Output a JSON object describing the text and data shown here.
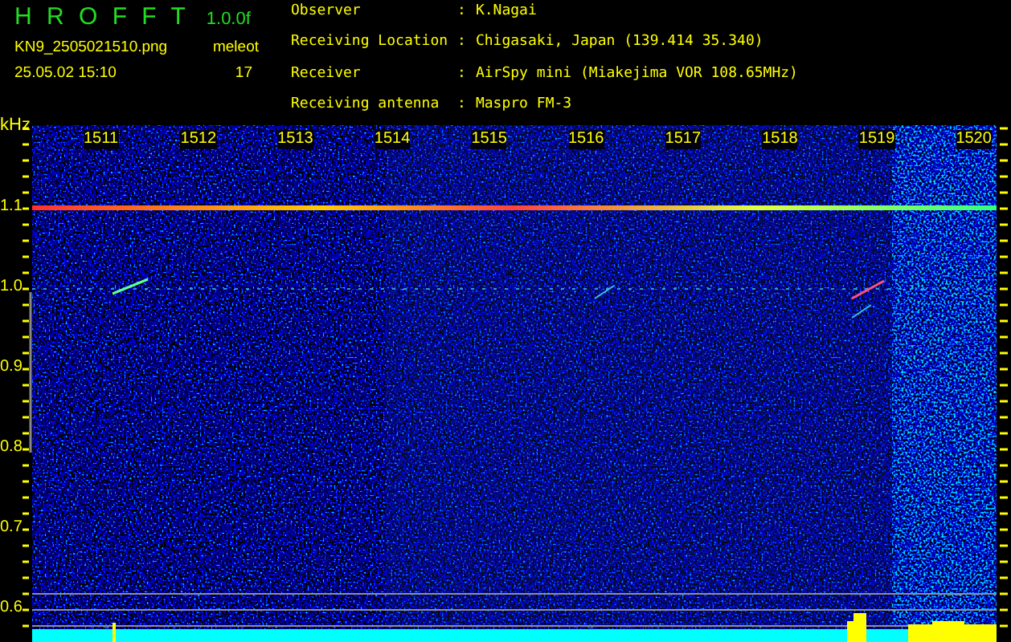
{
  "header": {
    "app_name": "H R O F F T",
    "version": "1.0.0f",
    "file_name": "KN9_2505021510.png",
    "date_time": "25.05.02 15:10",
    "count_label": "meleot",
    "count": "17"
  },
  "station_info": [
    {
      "label": "Observer",
      "separator": ":",
      "value": "K.Nagai"
    },
    {
      "label": "Receiving Location",
      "separator": ":",
      "value": "Chigasaki, Japan (139.414 35.340)"
    },
    {
      "label": "Receiver",
      "separator": ":",
      "value": "AirSpy mini (Miakejima VOR 108.65MHz)"
    },
    {
      "label": "Receiving antenna",
      "separator": ":",
      "value": "Maspro FM-3"
    }
  ],
  "spectrogram": {
    "unit": "kHz",
    "frequency_labels": [
      "1511",
      "1512",
      "1513",
      "1514",
      "1515",
      "1516",
      "1517",
      "1518",
      "1519",
      "1520"
    ],
    "y_ticks": [
      "1.1",
      "1.0",
      "0.9",
      "0.8",
      "0.7",
      "0.6"
    ]
  }
}
